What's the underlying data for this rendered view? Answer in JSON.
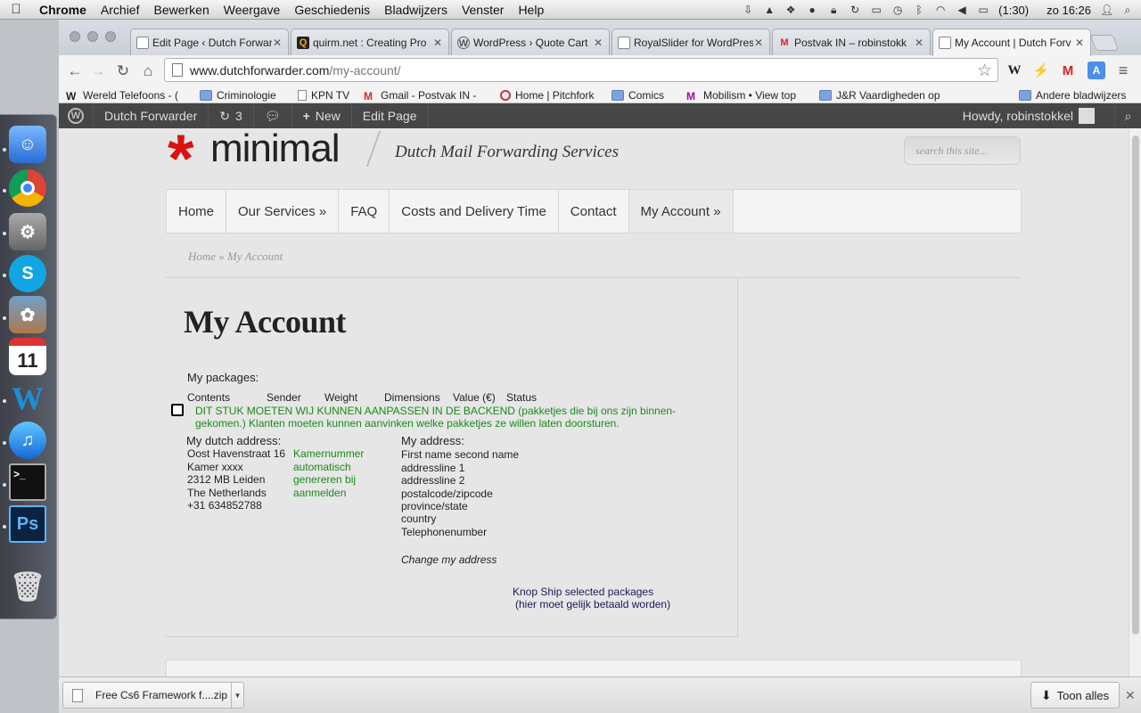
{
  "menubar": {
    "app": "Chrome",
    "items": [
      "Archief",
      "Bewerken",
      "Weergave",
      "Geschiedenis",
      "Bladwijzers",
      "Venster",
      "Help"
    ],
    "battery": "(1:30)",
    "clock": "zo 16:26"
  },
  "tabs": [
    {
      "title": "Edit Page ‹ Dutch Forwar",
      "active": false
    },
    {
      "title": "quirm.net : Creating Pro",
      "active": false
    },
    {
      "title": "WordPress › Quote Cart",
      "active": false
    },
    {
      "title": "RoyalSlider for WordPres",
      "active": false
    },
    {
      "title": "Postvak IN – robinstokk",
      "active": false
    },
    {
      "title": "My Account | Dutch Forv",
      "active": true
    }
  ],
  "address": {
    "host": "www.dutchforwarder.com",
    "path": "/my-account/"
  },
  "bookmarks": [
    {
      "label": "Wereld Telefoons - (",
      "icon": "page"
    },
    {
      "label": "Criminologie",
      "icon": "folder"
    },
    {
      "label": "KPN TV",
      "icon": "page"
    },
    {
      "label": "Gmail - Postvak IN -",
      "icon": "gmail"
    },
    {
      "label": "Home | Pitchfork",
      "icon": "pitchfork"
    },
    {
      "label": "Comics",
      "icon": "folder"
    },
    {
      "label": "Mobilism • View top",
      "icon": "m"
    },
    {
      "label": "J&R Vaardigheden op",
      "icon": "folder"
    },
    {
      "label": "Andere bladwijzers",
      "icon": "folder"
    }
  ],
  "adminbar": {
    "site": "Dutch Forwarder",
    "updates": "3",
    "new": "New",
    "edit": "Edit Page",
    "howdy": "Howdy, robinstokkel"
  },
  "site": {
    "logo_ast": "*",
    "logo_text": "minimal",
    "tagline": "Dutch Mail Forwarding Services",
    "search_placeholder": "search this site..."
  },
  "nav": [
    "Home",
    "Our Services »",
    "FAQ",
    "Costs and Delivery Time",
    "Contact",
    "My Account »"
  ],
  "breadcrumb": "Home » My Account",
  "page": {
    "title": "My Account",
    "packages_label": "My packages:",
    "columns": [
      "Contents",
      "Sender",
      "Weight",
      "Dimensions",
      "Value (€)",
      "Status"
    ],
    "note_line1": "DIT STUK MOETEN WIJ KUNNEN AANPASSEN IN DE BACKEND (pakketjes die bij ons zijn binnen-",
    "note_line2": "gekomen.) Klanten moeten kunnen aanvinken welke pakketjes ze willen laten doorsturen.",
    "dutch_heading": "My dutch address:",
    "dutch_lines": [
      "Oost Havenstraat 16",
      "Kamer xxxx",
      "2312 MB Leiden",
      "The Netherlands",
      "+31 634852788"
    ],
    "kamer_note": [
      "Kamernummer",
      "automatisch",
      "genereren bij",
      "aanmelden"
    ],
    "my_heading": "My address:",
    "my_lines": [
      "First name second name",
      "addressline 1",
      "addressline 2",
      "postalcode/zipcode",
      "province/state",
      "country",
      "Telephonenumber"
    ],
    "change_link": "Change my address",
    "ship_line1": "Knop Ship selected packages",
    "ship_line2": "(hier moet gelijk betaald worden)"
  },
  "download": {
    "file": "Free Cs6 Framework f....zip",
    "show_all": "Toon alles"
  },
  "colors": {
    "accent_red": "#dd1111",
    "note_green": "#1a8a1a",
    "admin_bar": "#464646"
  }
}
